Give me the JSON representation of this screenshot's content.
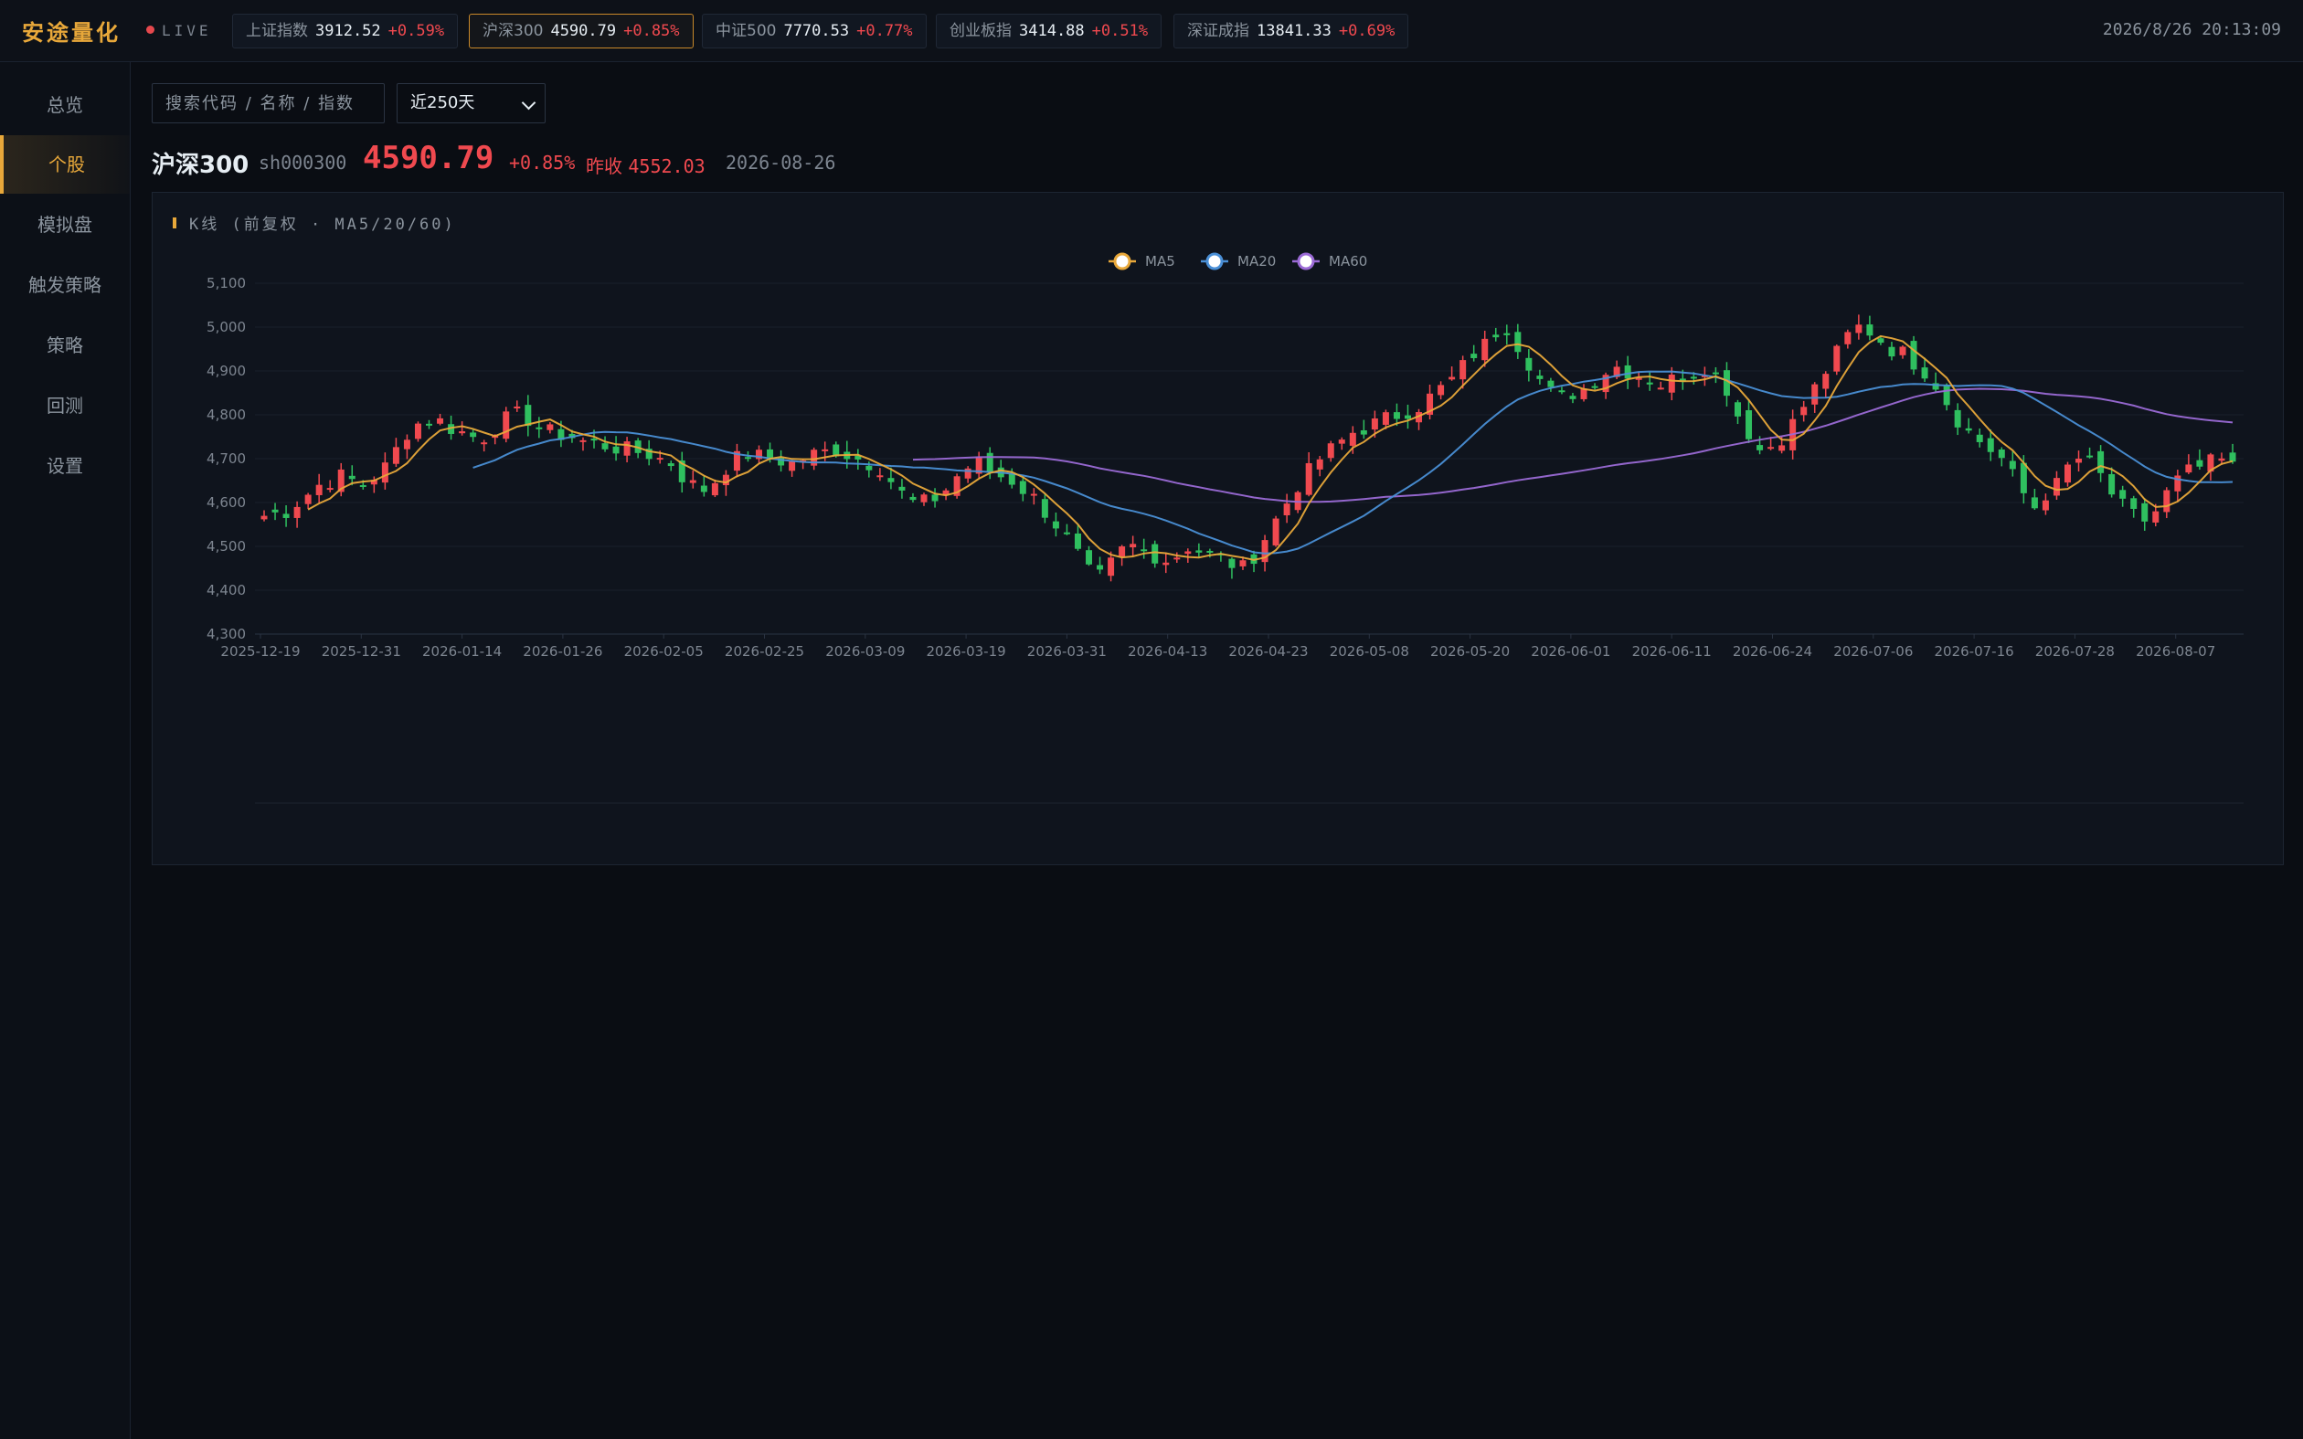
{
  "app": {
    "brand": "安途量化",
    "live_label": "LIVE",
    "clock": "2026/8/26 20:13:09"
  },
  "tickers": [
    {
      "name": "上证指数",
      "price": "3912.52",
      "change": "+0.59%",
      "active": false
    },
    {
      "name": "沪深300",
      "price": "4590.79",
      "change": "+0.85%",
      "active": true
    },
    {
      "name": "中证500",
      "price": "7770.53",
      "change": "+0.77%",
      "active": false
    },
    {
      "name": "创业板指",
      "price": "3414.88",
      "change": "+0.51%",
      "active": false
    },
    {
      "name": "深证成指",
      "price": "13841.33",
      "change": "+0.69%",
      "active": false
    }
  ],
  "sidebar": {
    "items": [
      {
        "label": "总览",
        "active": false
      },
      {
        "label": "个股",
        "active": true
      },
      {
        "label": "模拟盘",
        "active": false
      },
      {
        "label": "触发策略",
        "active": false
      },
      {
        "label": "策略",
        "active": false
      },
      {
        "label": "回测",
        "active": false
      },
      {
        "label": "设置",
        "active": false
      }
    ]
  },
  "controls": {
    "search_placeholder": "搜索代码 / 名称 / 指数",
    "range_value": "近250天"
  },
  "quote": {
    "name": "沪深300",
    "code": "sh000300",
    "price": "4590.79",
    "change": "+0.85%",
    "prev_close_label": "昨收",
    "prev_close": "4552.03",
    "date": "2026-08-26"
  },
  "panel": {
    "title": "K线 (前复权 · MA5/20/60)"
  },
  "colors": {
    "up": "#f0494f",
    "down": "#2fbf5f",
    "accent": "#e8a83a",
    "ma5": "#e8a83a",
    "ma20": "#4a8fd6",
    "ma60": "#9b6ad6"
  },
  "chart_data": {
    "type": "candlestick",
    "title": "K线 (前复权 · MA5/20/60)",
    "legend": [
      "MA5",
      "MA20",
      "MA60"
    ],
    "legend_placement": "top-center",
    "y_ticks": [
      4300,
      4400,
      4500,
      4600,
      4700,
      4800,
      4900,
      5000,
      5100
    ],
    "ylim": [
      4300,
      5100
    ],
    "x_tick_labels": [
      "2025-12-19",
      "2025-12-31",
      "2026-01-14",
      "2026-01-26",
      "2026-02-05",
      "2026-02-25",
      "2026-03-09",
      "2026-03-19",
      "2026-03-31",
      "2026-04-13",
      "2026-04-23",
      "2026-05-08",
      "2026-05-20",
      "2026-06-01",
      "2026-06-11",
      "2026-06-24",
      "2026-07-06",
      "2026-07-16",
      "2026-07-28",
      "2026-08-07"
    ],
    "close_trend": [
      [
        4570,
        4575,
        4580,
        4600,
        4620,
        4640,
        4650,
        4660,
        4650,
        4640
      ],
      [
        4660,
        4680,
        4720,
        4760,
        4780,
        4790,
        4785,
        4770,
        4760,
        4750
      ],
      [
        4750,
        4770,
        4790,
        4800,
        4790,
        4770,
        4760,
        4755,
        4750,
        4740
      ],
      [
        4735,
        4730,
        4725,
        4720,
        4715,
        4710,
        4700,
        4690,
        4660,
        4640
      ],
      [
        4630,
        4650,
        4680,
        4700,
        4710,
        4705,
        4700,
        4695,
        4690,
        4700
      ],
      [
        4710,
        4715,
        4720,
        4710,
        4700,
        4690,
        4680,
        4650,
        4620,
        4600
      ],
      [
        4600,
        4610,
        4630,
        4660,
        4680,
        4690,
        4670,
        4660,
        4650,
        4630
      ],
      [
        4610,
        4580,
        4550,
        4520,
        4480,
        4440,
        4430,
        4460,
        4490,
        4500
      ],
      [
        4490,
        4480,
        4470,
        4480,
        4500,
        4490,
        4480,
        4470,
        4460,
        4450
      ],
      [
        4480,
        4520,
        4560,
        4600,
        4640,
        4670,
        4700,
        4720,
        4740,
        4760
      ],
      [
        4770,
        4780,
        4790,
        4800,
        4810,
        4820,
        4840,
        4860,
        4880,
        4910
      ],
      [
        4940,
        4960,
        4990,
        5000,
        4960,
        4920,
        4880,
        4850,
        4840,
        4850
      ],
      [
        4860,
        4880,
        4900,
        4910,
        4900,
        4890,
        4880,
        4870,
        4880,
        4890
      ],
      [
        4900,
        4910,
        4890,
        4860,
        4800,
        4760,
        4720,
        4730,
        4750,
        4780
      ],
      [
        4820,
        4860,
        4900,
        4940,
        4980,
        5000,
        4990,
        4970,
        4950,
        4940
      ],
      [
        4920,
        4900,
        4870,
        4830,
        4790,
        4760,
        4740,
        4720,
        4700,
        4660
      ],
      [
        4620,
        4590,
        4620,
        4640,
        4680,
        4700,
        4690,
        4660,
        4620,
        4590
      ],
      [
        4570,
        4560,
        4580,
        4620,
        4650,
        4670,
        4680,
        4690,
        4695,
        4680
      ]
    ],
    "candle_count": 180,
    "series": [
      {
        "name": "MA5"
      },
      {
        "name": "MA20"
      },
      {
        "name": "MA60"
      }
    ]
  }
}
